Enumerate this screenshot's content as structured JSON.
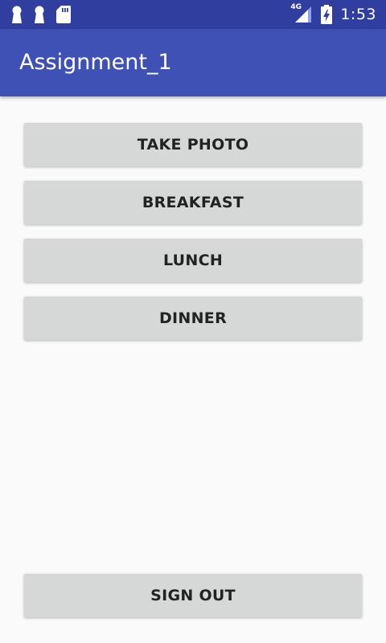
{
  "status_bar": {
    "network": "4G",
    "time": "1:53",
    "left_icons": [
      "keyhole-icon",
      "keyhole-icon",
      "sd-card-icon"
    ],
    "right_icons": [
      "signal-icon",
      "battery-charging-icon"
    ]
  },
  "app_bar": {
    "title": "Assignment_1",
    "color": "#3f51b5",
    "status_color": "#303f9f"
  },
  "buttons": {
    "take_photo": "TAKE PHOTO",
    "breakfast": "BREAKFAST",
    "lunch": "LUNCH",
    "dinner": "DINNER",
    "sign_out": "SIGN OUT"
  }
}
